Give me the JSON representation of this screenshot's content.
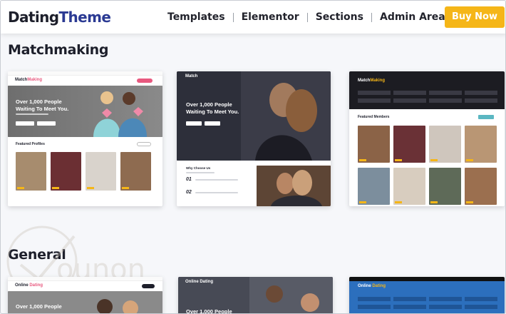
{
  "header": {
    "logo_part1": "Dating",
    "logo_part2": "Theme",
    "nav": [
      "Templates",
      "Elementor",
      "Sections",
      "Admin Area"
    ],
    "buy_label": "Buy Now"
  },
  "sections": {
    "matchmaking": "Matchmaking",
    "general": "General"
  },
  "templates": {
    "t1": {
      "logo_a": "Match",
      "logo_b": "Making",
      "hero_line1": "Over 1,000 People",
      "hero_line2": "Waiting To Meet You.",
      "featured": "Featured Profiles"
    },
    "t2": {
      "logo": "Match",
      "hero_line1": "Over 1,000 People",
      "hero_line2": "Waiting To Meet You.",
      "why": "Why Choose Us",
      "num1": "01",
      "num2": "02"
    },
    "t3": {
      "logo_a": "Match",
      "logo_b": "Making",
      "featured": "Featured Members"
    },
    "t4": {
      "logo_a": "Online",
      "logo_b": "Dating",
      "hero_line1": "Over 1,000 People"
    },
    "t5": {
      "logo": "Online Dating",
      "hero_line1": "Over 1,000 People"
    },
    "t6": {
      "logo_a": "Online",
      "logo_b": "Dating"
    }
  },
  "colors": {
    "accent_yellow": "#f5b618",
    "brand_blue": "#2b3a93",
    "pink": "#e8597f"
  }
}
